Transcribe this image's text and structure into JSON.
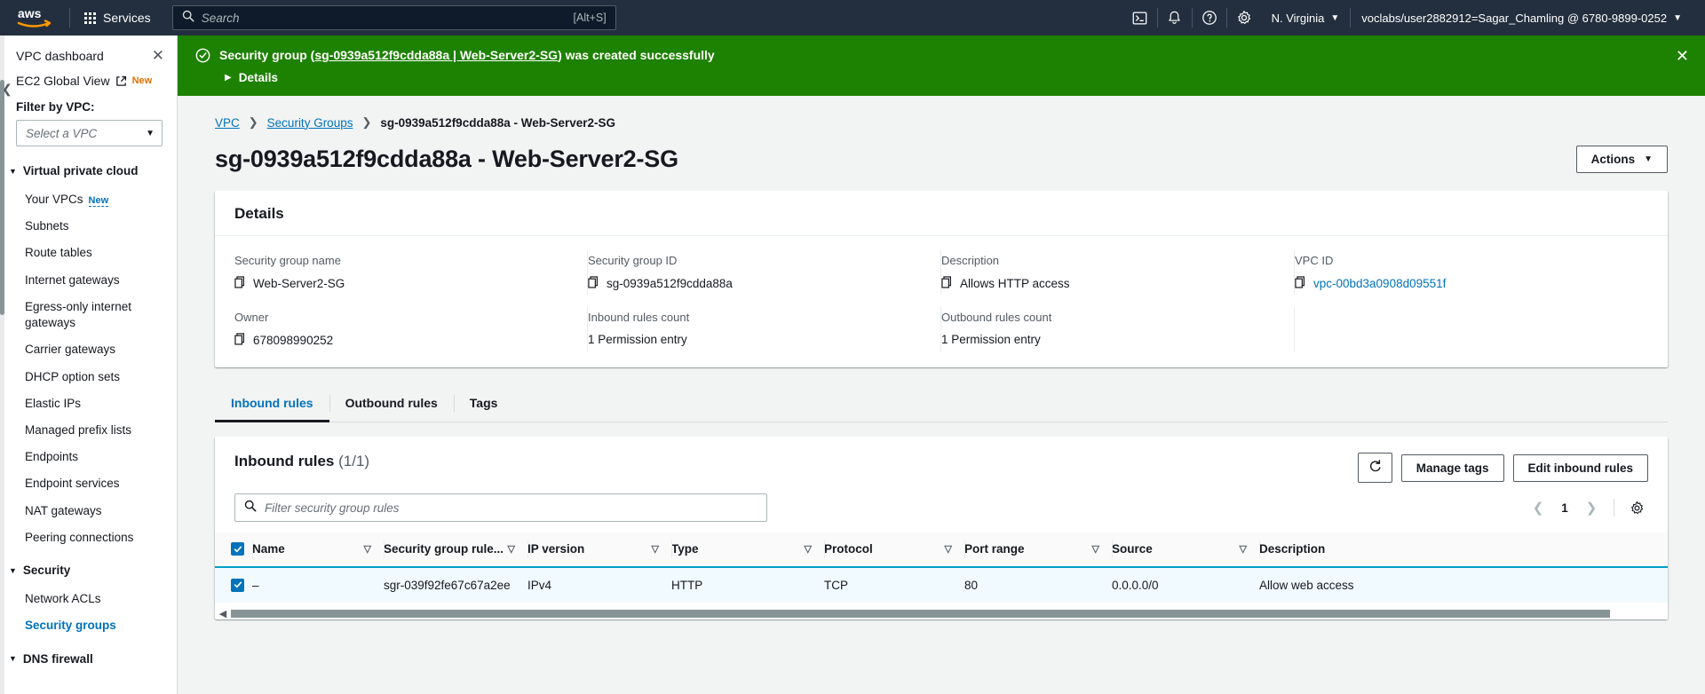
{
  "topnav": {
    "logo_alt": "aws",
    "services_label": "Services",
    "search_placeholder": "Search",
    "search_value": "",
    "search_shortcut": "[Alt+S]",
    "cloudshell_icon": "cloudshell-icon",
    "bell_icon": "notifications-icon",
    "help_icon": "help-icon",
    "settings_icon": "settings-icon",
    "region": "N. Virginia",
    "account": "voclabs/user2882912=Sagar_Chamling @ 6780-9899-0252"
  },
  "sidebar": {
    "dashboard_label": "VPC dashboard",
    "close_icon": "close-icon",
    "ec2_global_view_label": "EC2 Global View",
    "ec2_badge": "New",
    "filter_label": "Filter by VPC:",
    "vpc_select_placeholder": "Select a VPC",
    "groups": [
      {
        "title": "Virtual private cloud",
        "expanded": true,
        "items": [
          {
            "label": "Your VPCs",
            "badge": "New",
            "active": false
          },
          {
            "label": "Subnets",
            "badge": "",
            "active": false
          },
          {
            "label": "Route tables",
            "badge": "",
            "active": false
          },
          {
            "label": "Internet gateways",
            "badge": "",
            "active": false
          },
          {
            "label": "Egress-only internet gateways",
            "badge": "",
            "active": false
          },
          {
            "label": "Carrier gateways",
            "badge": "",
            "active": false
          },
          {
            "label": "DHCP option sets",
            "badge": "",
            "active": false
          },
          {
            "label": "Elastic IPs",
            "badge": "",
            "active": false
          },
          {
            "label": "Managed prefix lists",
            "badge": "",
            "active": false
          },
          {
            "label": "Endpoints",
            "badge": "",
            "active": false
          },
          {
            "label": "Endpoint services",
            "badge": "",
            "active": false
          },
          {
            "label": "NAT gateways",
            "badge": "",
            "active": false
          },
          {
            "label": "Peering connections",
            "badge": "",
            "active": false
          }
        ]
      },
      {
        "title": "Security",
        "expanded": true,
        "items": [
          {
            "label": "Network ACLs",
            "badge": "",
            "active": false
          },
          {
            "label": "Security groups",
            "badge": "",
            "active": true
          }
        ]
      },
      {
        "title": "DNS firewall",
        "expanded": true,
        "items": []
      }
    ]
  },
  "flash": {
    "icon": "success-check-icon",
    "text_before": "Security group (",
    "link_text": "sg-0939a512f9cdda88a | Web-Server2-SG",
    "text_after": ") was created successfully",
    "details_label": "Details",
    "close_icon": "close-icon",
    "color": "#1d8102"
  },
  "breadcrumb": {
    "items": [
      {
        "label": "VPC",
        "link": true
      },
      {
        "label": "Security Groups",
        "link": true
      },
      {
        "label": "sg-0939a512f9cdda88a - Web-Server2-SG",
        "link": false
      }
    ]
  },
  "page": {
    "title": "sg-0939a512f9cdda88a - Web-Server2-SG",
    "actions_label": "Actions"
  },
  "details": {
    "heading": "Details",
    "fields": [
      {
        "label": "Security group name",
        "value": "Web-Server2-SG",
        "copy": true,
        "link": false
      },
      {
        "label": "Security group ID",
        "value": "sg-0939a512f9cdda88a",
        "copy": true,
        "link": false
      },
      {
        "label": "Description",
        "value": "Allows HTTP access",
        "copy": true,
        "link": false
      },
      {
        "label": "VPC ID",
        "value": "vpc-00bd3a0908d09551f",
        "copy": true,
        "link": true
      },
      {
        "label": "Owner",
        "value": "678098990252",
        "copy": true,
        "link": false
      },
      {
        "label": "Inbound rules count",
        "value": "1 Permission entry",
        "copy": false,
        "link": false
      },
      {
        "label": "Outbound rules count",
        "value": "1 Permission entry",
        "copy": false,
        "link": false
      },
      {
        "label": "",
        "value": "",
        "copy": false,
        "link": false
      }
    ]
  },
  "tabs": [
    {
      "label": "Inbound rules",
      "active": true
    },
    {
      "label": "Outbound rules",
      "active": false
    },
    {
      "label": "Tags",
      "active": false
    }
  ],
  "rules_panel": {
    "title": "Inbound rules",
    "count": "(1/1)",
    "refresh_icon": "refresh-icon",
    "manage_tags_label": "Manage tags",
    "edit_rules_label": "Edit inbound rules",
    "filter_placeholder": "Filter security group rules",
    "filter_value": "",
    "search_icon": "search-icon",
    "page_prev_icon": "chevron-left-icon",
    "page_number": "1",
    "page_next_icon": "chevron-right-icon",
    "settings_icon": "gear-icon",
    "columns": [
      "Name",
      "Security group rule...",
      "IP version",
      "Type",
      "Protocol",
      "Port range",
      "Source",
      "Description"
    ],
    "rows": [
      {
        "selected": true,
        "name": "–",
        "rule_id": "sgr-039f92fe67c67a2ee",
        "ip_version": "IPv4",
        "type": "HTTP",
        "protocol": "TCP",
        "port_range": "80",
        "source": "0.0.0.0/0",
        "description": "Allow web access"
      }
    ]
  },
  "colors": {
    "nav_bg": "#232f3e",
    "success_green": "#1d8102",
    "link_blue": "#0073bb",
    "selected_row": "#f1faff",
    "selected_border": "#00a1c9",
    "page_bg": "#f2f3f3"
  }
}
